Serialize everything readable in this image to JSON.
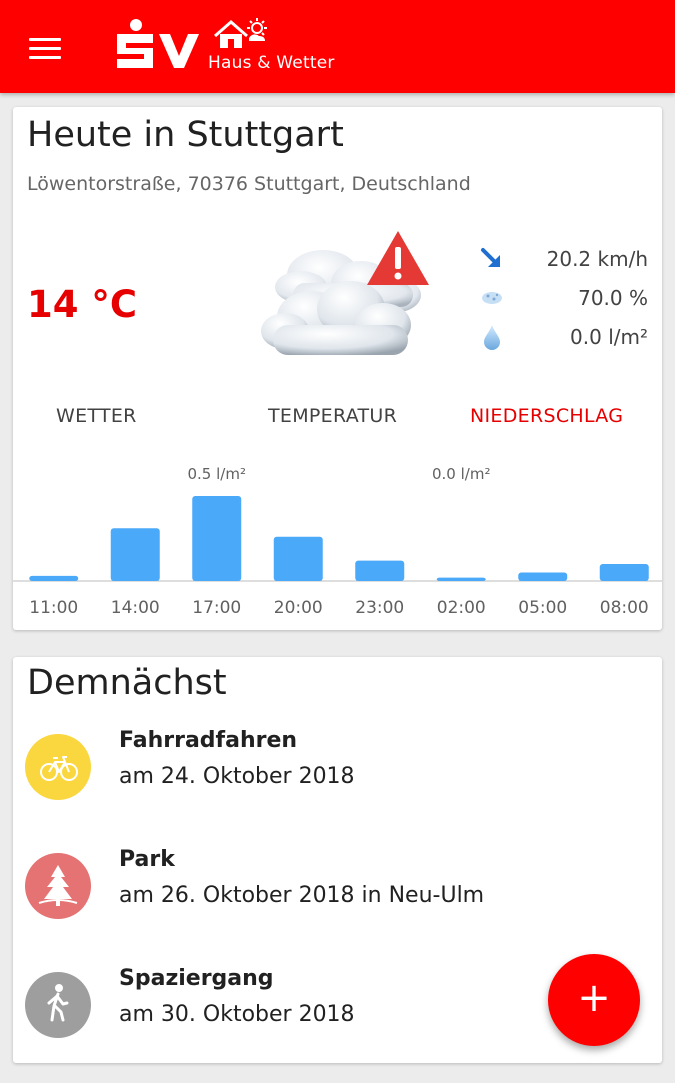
{
  "header": {
    "brand": "SV",
    "subtitle": "Haus & Wetter",
    "menu_icon": "hamburger-icon",
    "colors": {
      "bar": "#ff0000",
      "text": "#ffffff"
    }
  },
  "today": {
    "title": "Heute in Stuttgart",
    "address": "Löwentorstraße, 70376 Stuttgart, Deutschland",
    "temperature": "14 °C",
    "condition_icon": "cloudy-with-warning-icon",
    "metrics": [
      {
        "icon": "wind-direction-icon",
        "value": "20.2 km/h"
      },
      {
        "icon": "humidity-icon",
        "value": "70.0 %"
      },
      {
        "icon": "raindrop-icon",
        "value": "0.0 l/m²"
      }
    ],
    "tabs": [
      {
        "label": "WETTER",
        "active": false
      },
      {
        "label": "TEMPERATUR",
        "active": false
      },
      {
        "label": "NIEDERSCHLAG",
        "active": true
      }
    ],
    "accent": "#e60000"
  },
  "chart_data": {
    "type": "bar",
    "categories": [
      "11:00",
      "14:00",
      "17:00",
      "20:00",
      "23:00",
      "02:00",
      "05:00",
      "08:00"
    ],
    "values": [
      0.03,
      0.31,
      0.5,
      0.26,
      0.12,
      0.02,
      0.05,
      0.1
    ],
    "annotations": [
      {
        "category": "17:00",
        "text": "0.5 l/m²"
      },
      {
        "category": "02:00",
        "text": "0.0 l/m²"
      }
    ],
    "ylim": [
      0,
      0.5
    ],
    "grid": false,
    "bar_color": "#4aa9f8"
  },
  "upcoming": {
    "title": "Demnächst",
    "events": [
      {
        "name": "Fahrradfahren",
        "date": "am 24. Oktober 2018",
        "icon": "bicycle-icon",
        "color": "#fad73f"
      },
      {
        "name": "Park",
        "date": "am 26. Oktober 2018 in Neu-Ulm",
        "icon": "tree-icon",
        "color": "#e57373"
      },
      {
        "name": "Spaziergang",
        "date": "am 30. Oktober 2018",
        "icon": "walking-person-icon",
        "color": "#9e9e9e"
      }
    ]
  },
  "fab": {
    "label": "+",
    "icon": "plus-icon"
  }
}
